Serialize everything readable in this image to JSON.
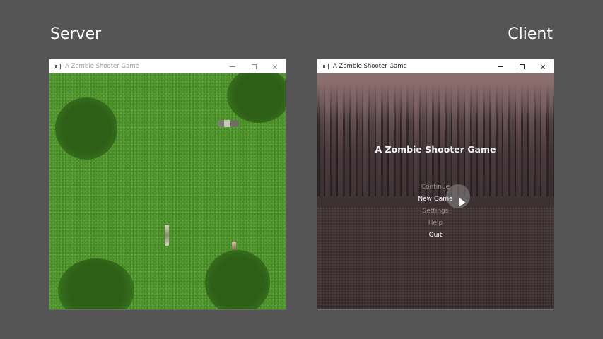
{
  "labels": {
    "server": "Server",
    "client": "Client"
  },
  "server_window": {
    "title": "A Zombie Shooter Game",
    "controls": [
      "minimize-icon",
      "maximize-icon",
      "close-icon"
    ]
  },
  "client_window": {
    "title": "A Zombie Shooter Game",
    "controls": [
      "minimize-icon",
      "maximize-icon",
      "close-icon"
    ],
    "game_title": "A Zombie Shooter Game",
    "menu": [
      {
        "label": "Continue",
        "active": false
      },
      {
        "label": "New Game",
        "active": true
      },
      {
        "label": "Settings",
        "active": false
      },
      {
        "label": "Help",
        "active": false
      },
      {
        "label": "Quit",
        "active": true
      }
    ]
  },
  "colors": {
    "background": "#555555",
    "grass": "#4f9530",
    "bush": "#2e5f17",
    "menu_text_active": "#ffffff",
    "menu_text_inactive": "#9a8d8e"
  },
  "icons": {
    "close": "×"
  }
}
